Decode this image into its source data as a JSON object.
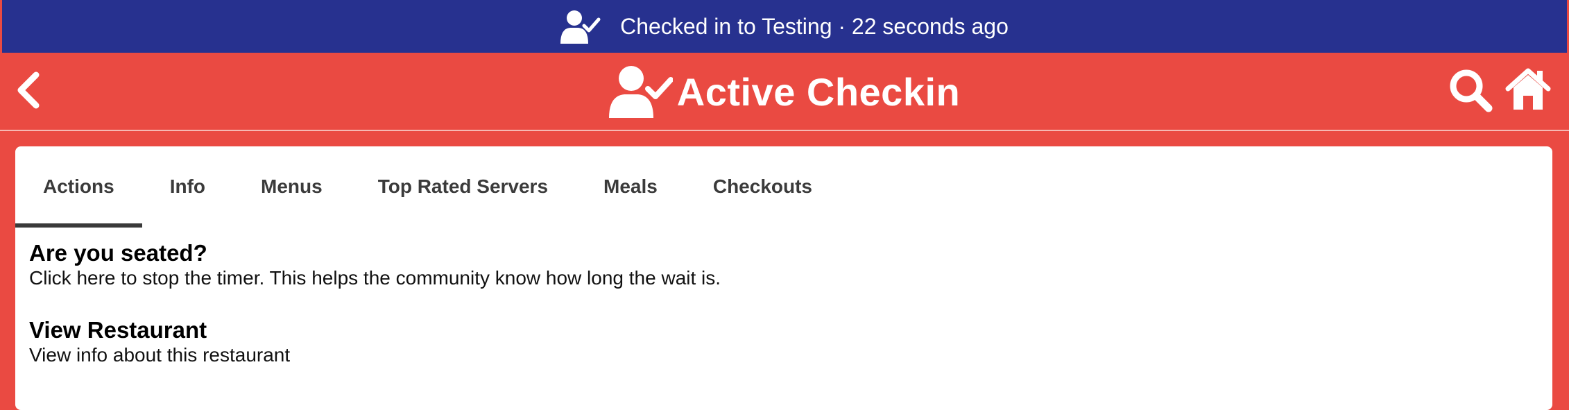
{
  "status_bar": {
    "icon": "user-check-icon",
    "text": "Checked in to Testing · 22 seconds ago"
  },
  "header": {
    "back_icon": "chevron-left-icon",
    "title_icon": "user-check-icon",
    "title": "Active Checkin",
    "search_icon": "search-icon",
    "home_icon": "home-icon"
  },
  "tabs": [
    {
      "label": "Actions",
      "active": true
    },
    {
      "label": "Info",
      "active": false
    },
    {
      "label": "Menus",
      "active": false
    },
    {
      "label": "Top Rated Servers",
      "active": false
    },
    {
      "label": "Meals",
      "active": false
    },
    {
      "label": "Checkouts",
      "active": false
    }
  ],
  "actions": [
    {
      "title": "Are you seated?",
      "description": "Click here to stop the timer. This helps the community know how long the wait is."
    },
    {
      "title": "View Restaurant",
      "description": "View info about this restaurant"
    }
  ],
  "colors": {
    "status_bar": "#27318f",
    "header": "#ea4a42",
    "panel": "#ffffff",
    "tab_text": "#3b3b3b",
    "tab_indicator": "#3a3a3a"
  }
}
